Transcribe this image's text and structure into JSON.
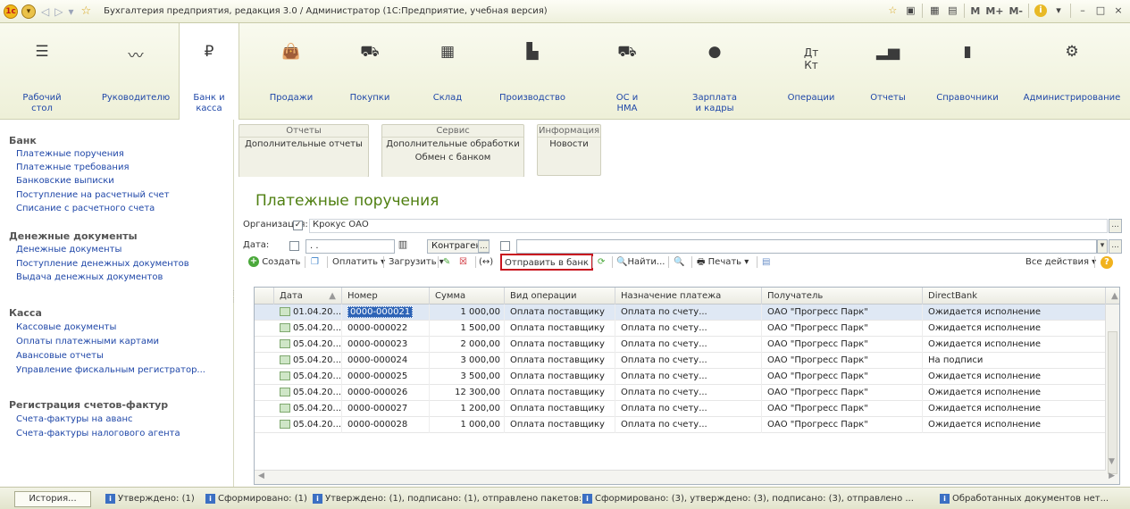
{
  "window": {
    "title": "Бухгалтерия предприятия, редакция 3.0 / Администратор  (1С:Предприятие, учебная версия)",
    "right_buttons": [
      "M",
      "M+",
      "M-"
    ]
  },
  "sections": [
    {
      "label": "Рабочий\nстол",
      "icon": "menu-icon"
    },
    {
      "label": "Руководителю",
      "icon": "chart-line-icon"
    },
    {
      "label": "Банк и\nкасса",
      "icon": "ruble-icon"
    },
    {
      "label": "Продажи",
      "icon": "bag-icon"
    },
    {
      "label": "Покупки",
      "icon": "cart-icon"
    },
    {
      "label": "Склад",
      "icon": "warehouse-icon"
    },
    {
      "label": "Производство",
      "icon": "factory-icon"
    },
    {
      "label": "ОС и\nНМА",
      "icon": "truck-icon"
    },
    {
      "label": "Зарплата\nи кадры",
      "icon": "person-icon"
    },
    {
      "label": "Операции",
      "icon": "debit-credit-icon"
    },
    {
      "label": "Отчеты",
      "icon": "bar-chart-icon"
    },
    {
      "label": "Справочники",
      "icon": "book-icon"
    },
    {
      "label": "Администрирование",
      "icon": "gear-icon"
    }
  ],
  "left_panel": {
    "groups": [
      {
        "title": "Банк",
        "items": [
          "Платежные поручения",
          "Платежные требования",
          "Банковские выписки",
          "Поступление на расчетный счет",
          "Списание с расчетного счета"
        ]
      },
      {
        "title": "Денежные документы",
        "items": [
          "Денежные документы",
          "Поступление денежных документов",
          "Выдача денежных документов"
        ]
      },
      {
        "title": "Касса",
        "items": [
          "Кассовые документы",
          "Оплаты платежными картами",
          "Авансовые отчеты",
          "Управление фискальным регистратор..."
        ]
      },
      {
        "title": "Регистрация счетов-фактур",
        "items": [
          "Счета-фактуры на аванс",
          "Счета-фактуры налогового агента"
        ]
      }
    ]
  },
  "command_groups": [
    {
      "title": "Отчеты",
      "items": [
        "Дополнительные отчеты"
      ]
    },
    {
      "title": "Сервис",
      "items": [
        "Дополнительные обработки",
        "Обмен с банком"
      ]
    },
    {
      "title": "Информация",
      "items": [
        "Новости"
      ]
    }
  ],
  "form": {
    "title": "Платежные поручения",
    "org_label": "Организация:",
    "org_value": "Крокус ОАО",
    "date_label": "Дата:",
    "date_value": ". .",
    "contractor_label": "Контрагент:",
    "ellipsis": "..."
  },
  "toolbar": {
    "create": "Создать",
    "pay": "Оплатить",
    "load": "Загрузить",
    "send_to_bank": "Отправить в банк",
    "find": "Найти...",
    "print": "Печать",
    "all_actions": "Все действия",
    "help": "?"
  },
  "table": {
    "columns": [
      "Дата",
      "Номер",
      "Сумма",
      "Вид операции",
      "Назначение платежа",
      "Получатель",
      "DirectBank"
    ],
    "rows": [
      {
        "date": "01.04.20...",
        "number": "0000-000021",
        "sum": "1 000,00",
        "op": "Оплата поставщику",
        "purpose": "Оплата по счету...",
        "recipient": "ОАО \"Прогресс Парк\"",
        "directbank": "Ожидается исполнение"
      },
      {
        "date": "05.04.20...",
        "number": "0000-000022",
        "sum": "1 500,00",
        "op": "Оплата поставщику",
        "purpose": "Оплата по счету...",
        "recipient": "ОАО \"Прогресс Парк\"",
        "directbank": "Ожидается исполнение"
      },
      {
        "date": "05.04.20...",
        "number": "0000-000023",
        "sum": "2 000,00",
        "op": "Оплата поставщику",
        "purpose": "Оплата по счету...",
        "recipient": "ОАО \"Прогресс Парк\"",
        "directbank": "Ожидается исполнение"
      },
      {
        "date": "05.04.20...",
        "number": "0000-000024",
        "sum": "3 000,00",
        "op": "Оплата поставщику",
        "purpose": "Оплата по счету...",
        "recipient": "ОАО \"Прогресс Парк\"",
        "directbank": "На подписи"
      },
      {
        "date": "05.04.20...",
        "number": "0000-000025",
        "sum": "3 500,00",
        "op": "Оплата поставщику",
        "purpose": "Оплата по счету...",
        "recipient": "ОАО \"Прогресс Парк\"",
        "directbank": "Ожидается исполнение"
      },
      {
        "date": "05.04.20...",
        "number": "0000-000026",
        "sum": "12 300,00",
        "op": "Оплата поставщику",
        "purpose": "Оплата по счету...",
        "recipient": "ОАО \"Прогресс Парк\"",
        "directbank": "Ожидается исполнение"
      },
      {
        "date": "05.04.20...",
        "number": "0000-000027",
        "sum": "1 200,00",
        "op": "Оплата поставщику",
        "purpose": "Оплата по счету...",
        "recipient": "ОАО \"Прогресс Парк\"",
        "directbank": "Ожидается исполнение"
      },
      {
        "date": "05.04.20...",
        "number": "0000-000028",
        "sum": "1 000,00",
        "op": "Оплата поставщику",
        "purpose": "Оплата по счету...",
        "recipient": "ОАО \"Прогресс Парк\"",
        "directbank": "Ожидается исполнение"
      }
    ]
  },
  "status_bar": {
    "history": "История...",
    "messages": [
      "Утверждено: (1)",
      "Сформировано: (1)",
      "Утверждено: (1), подписано: (1), отправлено пакетов: (1)",
      "Сформировано: (3), утверждено: (3), подписано: (3), отправлено ...",
      "Обработанных документов нет..."
    ]
  },
  "colors": {
    "accent_green": "#4f7f11",
    "link_blue": "#1f47a8",
    "highlight_red": "#c8141e"
  }
}
